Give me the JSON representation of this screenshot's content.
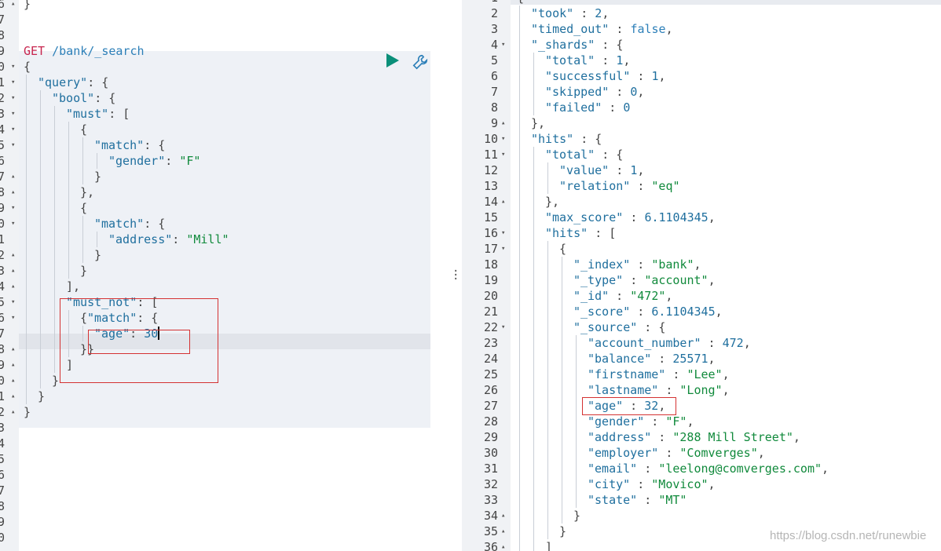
{
  "request": {
    "method": "GET",
    "path": "/bank/_search",
    "lines": [
      {
        "ln": "6",
        "fold": "▴",
        "indent": 0,
        "tokens": [
          [
            "p",
            "}"
          ]
        ]
      },
      {
        "ln": "7",
        "fold": "",
        "indent": 0,
        "tokens": []
      },
      {
        "ln": "8",
        "fold": "",
        "indent": 0,
        "tokens": []
      },
      {
        "ln": "9",
        "fold": "",
        "indent": 0,
        "tokens": [
          [
            "kw",
            "GET"
          ],
          [
            "p",
            " "
          ],
          [
            "b",
            "/bank/_search"
          ]
        ]
      },
      {
        "ln": "0",
        "fold": "▾",
        "indent": 0,
        "tokens": [
          [
            "p",
            "{"
          ]
        ]
      },
      {
        "ln": "1",
        "fold": "▾",
        "indent": 1,
        "tokens": [
          [
            "k",
            "\"query\""
          ],
          [
            "p",
            ": {"
          ]
        ]
      },
      {
        "ln": "2",
        "fold": "▾",
        "indent": 2,
        "tokens": [
          [
            "k",
            "\"bool\""
          ],
          [
            "p",
            ": {"
          ]
        ]
      },
      {
        "ln": "3",
        "fold": "▾",
        "indent": 3,
        "tokens": [
          [
            "k",
            "\"must\""
          ],
          [
            "p",
            ": ["
          ]
        ]
      },
      {
        "ln": "4",
        "fold": "▾",
        "indent": 4,
        "tokens": [
          [
            "p",
            "{"
          ]
        ]
      },
      {
        "ln": "5",
        "fold": "▾",
        "indent": 5,
        "tokens": [
          [
            "k",
            "\"match\""
          ],
          [
            "p",
            ": {"
          ]
        ]
      },
      {
        "ln": "6",
        "fold": "",
        "indent": 6,
        "tokens": [
          [
            "k",
            "\"gender\""
          ],
          [
            "p",
            ": "
          ],
          [
            "s",
            "\"F\""
          ]
        ]
      },
      {
        "ln": "7",
        "fold": "▴",
        "indent": 5,
        "tokens": [
          [
            "p",
            "}"
          ]
        ]
      },
      {
        "ln": "8",
        "fold": "▴",
        "indent": 4,
        "tokens": [
          [
            "p",
            "},"
          ]
        ]
      },
      {
        "ln": "9",
        "fold": "▾",
        "indent": 4,
        "tokens": [
          [
            "p",
            "{"
          ]
        ]
      },
      {
        "ln": "0",
        "fold": "▾",
        "indent": 5,
        "tokens": [
          [
            "k",
            "\"match\""
          ],
          [
            "p",
            ": {"
          ]
        ]
      },
      {
        "ln": "1",
        "fold": "",
        "indent": 6,
        "tokens": [
          [
            "k",
            "\"address\""
          ],
          [
            "p",
            ": "
          ],
          [
            "s",
            "\"Mill\""
          ]
        ]
      },
      {
        "ln": "2",
        "fold": "▴",
        "indent": 5,
        "tokens": [
          [
            "p",
            "}"
          ]
        ]
      },
      {
        "ln": "3",
        "fold": "▴",
        "indent": 4,
        "tokens": [
          [
            "p",
            "}"
          ]
        ]
      },
      {
        "ln": "4",
        "fold": "▴",
        "indent": 3,
        "tokens": [
          [
            "p",
            "],"
          ]
        ]
      },
      {
        "ln": "5",
        "fold": "▾",
        "indent": 3,
        "tokens": [
          [
            "k",
            "\"must_not\""
          ],
          [
            "p",
            ": ["
          ]
        ]
      },
      {
        "ln": "6",
        "fold": "▾",
        "indent": 4,
        "tokens": [
          [
            "p",
            "{"
          ],
          [
            "k",
            "\"match\""
          ],
          [
            "p",
            ": {"
          ]
        ]
      },
      {
        "ln": "7",
        "fold": "",
        "indent": 5,
        "tokens": [
          [
            "k",
            "\"age\""
          ],
          [
            "p",
            ": "
          ],
          [
            "n",
            "30"
          ]
        ]
      },
      {
        "ln": "8",
        "fold": "▴",
        "indent": 4,
        "tokens": [
          [
            "p",
            "}}"
          ]
        ]
      },
      {
        "ln": "9",
        "fold": "▴",
        "indent": 3,
        "tokens": [
          [
            "p",
            "]"
          ]
        ]
      },
      {
        "ln": "0",
        "fold": "▴",
        "indent": 2,
        "tokens": [
          [
            "p",
            "}"
          ]
        ]
      },
      {
        "ln": "1",
        "fold": "▴",
        "indent": 1,
        "tokens": [
          [
            "p",
            "}"
          ]
        ]
      },
      {
        "ln": "2",
        "fold": "▴",
        "indent": 0,
        "tokens": [
          [
            "p",
            "}"
          ]
        ]
      },
      {
        "ln": "3",
        "fold": "",
        "indent": 0,
        "tokens": []
      },
      {
        "ln": "4",
        "fold": "",
        "indent": 0,
        "tokens": []
      },
      {
        "ln": "5",
        "fold": "",
        "indent": 0,
        "tokens": []
      },
      {
        "ln": "6",
        "fold": "",
        "indent": 0,
        "tokens": []
      },
      {
        "ln": "7",
        "fold": "",
        "indent": 0,
        "tokens": []
      },
      {
        "ln": "8",
        "fold": "",
        "indent": 0,
        "tokens": []
      },
      {
        "ln": "9",
        "fold": "",
        "indent": 0,
        "tokens": []
      },
      {
        "ln": "0",
        "fold": "",
        "indent": 0,
        "tokens": []
      }
    ]
  },
  "response": {
    "lines": [
      {
        "ln": "1",
        "fold": "▾",
        "indent": 0,
        "tokens": [
          [
            "p",
            "{"
          ]
        ]
      },
      {
        "ln": "2",
        "fold": "",
        "indent": 1,
        "tokens": [
          [
            "k",
            "\"took\""
          ],
          [
            "p",
            " : "
          ],
          [
            "n",
            "2"
          ],
          [
            "p",
            ","
          ]
        ]
      },
      {
        "ln": "3",
        "fold": "",
        "indent": 1,
        "tokens": [
          [
            "k",
            "\"timed_out\""
          ],
          [
            "p",
            " : "
          ],
          [
            "b",
            "false"
          ],
          [
            "p",
            ","
          ]
        ]
      },
      {
        "ln": "4",
        "fold": "▾",
        "indent": 1,
        "tokens": [
          [
            "k",
            "\"_shards\""
          ],
          [
            "p",
            " : {"
          ]
        ]
      },
      {
        "ln": "5",
        "fold": "",
        "indent": 2,
        "tokens": [
          [
            "k",
            "\"total\""
          ],
          [
            "p",
            " : "
          ],
          [
            "n",
            "1"
          ],
          [
            "p",
            ","
          ]
        ]
      },
      {
        "ln": "6",
        "fold": "",
        "indent": 2,
        "tokens": [
          [
            "k",
            "\"successful\""
          ],
          [
            "p",
            " : "
          ],
          [
            "n",
            "1"
          ],
          [
            "p",
            ","
          ]
        ]
      },
      {
        "ln": "7",
        "fold": "",
        "indent": 2,
        "tokens": [
          [
            "k",
            "\"skipped\""
          ],
          [
            "p",
            " : "
          ],
          [
            "n",
            "0"
          ],
          [
            "p",
            ","
          ]
        ]
      },
      {
        "ln": "8",
        "fold": "",
        "indent": 2,
        "tokens": [
          [
            "k",
            "\"failed\""
          ],
          [
            "p",
            " : "
          ],
          [
            "n",
            "0"
          ]
        ]
      },
      {
        "ln": "9",
        "fold": "▴",
        "indent": 1,
        "tokens": [
          [
            "p",
            "},"
          ]
        ]
      },
      {
        "ln": "10",
        "fold": "▾",
        "indent": 1,
        "tokens": [
          [
            "k",
            "\"hits\""
          ],
          [
            "p",
            " : {"
          ]
        ]
      },
      {
        "ln": "11",
        "fold": "▾",
        "indent": 2,
        "tokens": [
          [
            "k",
            "\"total\""
          ],
          [
            "p",
            " : {"
          ]
        ]
      },
      {
        "ln": "12",
        "fold": "",
        "indent": 3,
        "tokens": [
          [
            "k",
            "\"value\""
          ],
          [
            "p",
            " : "
          ],
          [
            "n",
            "1"
          ],
          [
            "p",
            ","
          ]
        ]
      },
      {
        "ln": "13",
        "fold": "",
        "indent": 3,
        "tokens": [
          [
            "k",
            "\"relation\""
          ],
          [
            "p",
            " : "
          ],
          [
            "s",
            "\"eq\""
          ]
        ]
      },
      {
        "ln": "14",
        "fold": "▴",
        "indent": 2,
        "tokens": [
          [
            "p",
            "},"
          ]
        ]
      },
      {
        "ln": "15",
        "fold": "",
        "indent": 2,
        "tokens": [
          [
            "k",
            "\"max_score\""
          ],
          [
            "p",
            " : "
          ],
          [
            "n",
            "6.1104345"
          ],
          [
            "p",
            ","
          ]
        ]
      },
      {
        "ln": "16",
        "fold": "▾",
        "indent": 2,
        "tokens": [
          [
            "k",
            "\"hits\""
          ],
          [
            "p",
            " : ["
          ]
        ]
      },
      {
        "ln": "17",
        "fold": "▾",
        "indent": 3,
        "tokens": [
          [
            "p",
            "{"
          ]
        ]
      },
      {
        "ln": "18",
        "fold": "",
        "indent": 4,
        "tokens": [
          [
            "k",
            "\"_index\""
          ],
          [
            "p",
            " : "
          ],
          [
            "s",
            "\"bank\""
          ],
          [
            "p",
            ","
          ]
        ]
      },
      {
        "ln": "19",
        "fold": "",
        "indent": 4,
        "tokens": [
          [
            "k",
            "\"_type\""
          ],
          [
            "p",
            " : "
          ],
          [
            "s",
            "\"account\""
          ],
          [
            "p",
            ","
          ]
        ]
      },
      {
        "ln": "20",
        "fold": "",
        "indent": 4,
        "tokens": [
          [
            "k",
            "\"_id\""
          ],
          [
            "p",
            " : "
          ],
          [
            "s",
            "\"472\""
          ],
          [
            "p",
            ","
          ]
        ]
      },
      {
        "ln": "21",
        "fold": "",
        "indent": 4,
        "tokens": [
          [
            "k",
            "\"_score\""
          ],
          [
            "p",
            " : "
          ],
          [
            "n",
            "6.1104345"
          ],
          [
            "p",
            ","
          ]
        ]
      },
      {
        "ln": "22",
        "fold": "▾",
        "indent": 4,
        "tokens": [
          [
            "k",
            "\"_source\""
          ],
          [
            "p",
            " : {"
          ]
        ]
      },
      {
        "ln": "23",
        "fold": "",
        "indent": 5,
        "tokens": [
          [
            "k",
            "\"account_number\""
          ],
          [
            "p",
            " : "
          ],
          [
            "n",
            "472"
          ],
          [
            "p",
            ","
          ]
        ]
      },
      {
        "ln": "24",
        "fold": "",
        "indent": 5,
        "tokens": [
          [
            "k",
            "\"balance\""
          ],
          [
            "p",
            " : "
          ],
          [
            "n",
            "25571"
          ],
          [
            "p",
            ","
          ]
        ]
      },
      {
        "ln": "25",
        "fold": "",
        "indent": 5,
        "tokens": [
          [
            "k",
            "\"firstname\""
          ],
          [
            "p",
            " : "
          ],
          [
            "s",
            "\"Lee\""
          ],
          [
            "p",
            ","
          ]
        ]
      },
      {
        "ln": "26",
        "fold": "",
        "indent": 5,
        "tokens": [
          [
            "k",
            "\"lastname\""
          ],
          [
            "p",
            " : "
          ],
          [
            "s",
            "\"Long\""
          ],
          [
            "p",
            ","
          ]
        ]
      },
      {
        "ln": "27",
        "fold": "",
        "indent": 5,
        "tokens": [
          [
            "k",
            "\"age\""
          ],
          [
            "p",
            " : "
          ],
          [
            "n",
            "32"
          ],
          [
            "p",
            ","
          ]
        ]
      },
      {
        "ln": "28",
        "fold": "",
        "indent": 5,
        "tokens": [
          [
            "k",
            "\"gender\""
          ],
          [
            "p",
            " : "
          ],
          [
            "s",
            "\"F\""
          ],
          [
            "p",
            ","
          ]
        ]
      },
      {
        "ln": "29",
        "fold": "",
        "indent": 5,
        "tokens": [
          [
            "k",
            "\"address\""
          ],
          [
            "p",
            " : "
          ],
          [
            "s",
            "\"288 Mill Street\""
          ],
          [
            "p",
            ","
          ]
        ]
      },
      {
        "ln": "30",
        "fold": "",
        "indent": 5,
        "tokens": [
          [
            "k",
            "\"employer\""
          ],
          [
            "p",
            " : "
          ],
          [
            "s",
            "\"Comverges\""
          ],
          [
            "p",
            ","
          ]
        ]
      },
      {
        "ln": "31",
        "fold": "",
        "indent": 5,
        "tokens": [
          [
            "k",
            "\"email\""
          ],
          [
            "p",
            " : "
          ],
          [
            "s",
            "\"leelong@comverges.com\""
          ],
          [
            "p",
            ","
          ]
        ]
      },
      {
        "ln": "32",
        "fold": "",
        "indent": 5,
        "tokens": [
          [
            "k",
            "\"city\""
          ],
          [
            "p",
            " : "
          ],
          [
            "s",
            "\"Movico\""
          ],
          [
            "p",
            ","
          ]
        ]
      },
      {
        "ln": "33",
        "fold": "",
        "indent": 5,
        "tokens": [
          [
            "k",
            "\"state\""
          ],
          [
            "p",
            " : "
          ],
          [
            "s",
            "\"MT\""
          ]
        ]
      },
      {
        "ln": "34",
        "fold": "▴",
        "indent": 4,
        "tokens": [
          [
            "p",
            "}"
          ]
        ]
      },
      {
        "ln": "35",
        "fold": "▴",
        "indent": 3,
        "tokens": [
          [
            "p",
            "}"
          ]
        ]
      },
      {
        "ln": "36",
        "fold": "▴",
        "indent": 2,
        "tokens": [
          [
            "p",
            "]"
          ]
        ]
      }
    ]
  },
  "icons": {
    "run": "play-icon",
    "settings": "wrench-icon",
    "resize": "vertical-grip-icon"
  },
  "colors": {
    "key": "#1f6f9e",
    "string": "#118a3c",
    "method": "#c7254e",
    "highlight_box": "#d43232",
    "run_button": "#0a8f79"
  },
  "watermark": "https://blog.csdn.net/runewbie"
}
